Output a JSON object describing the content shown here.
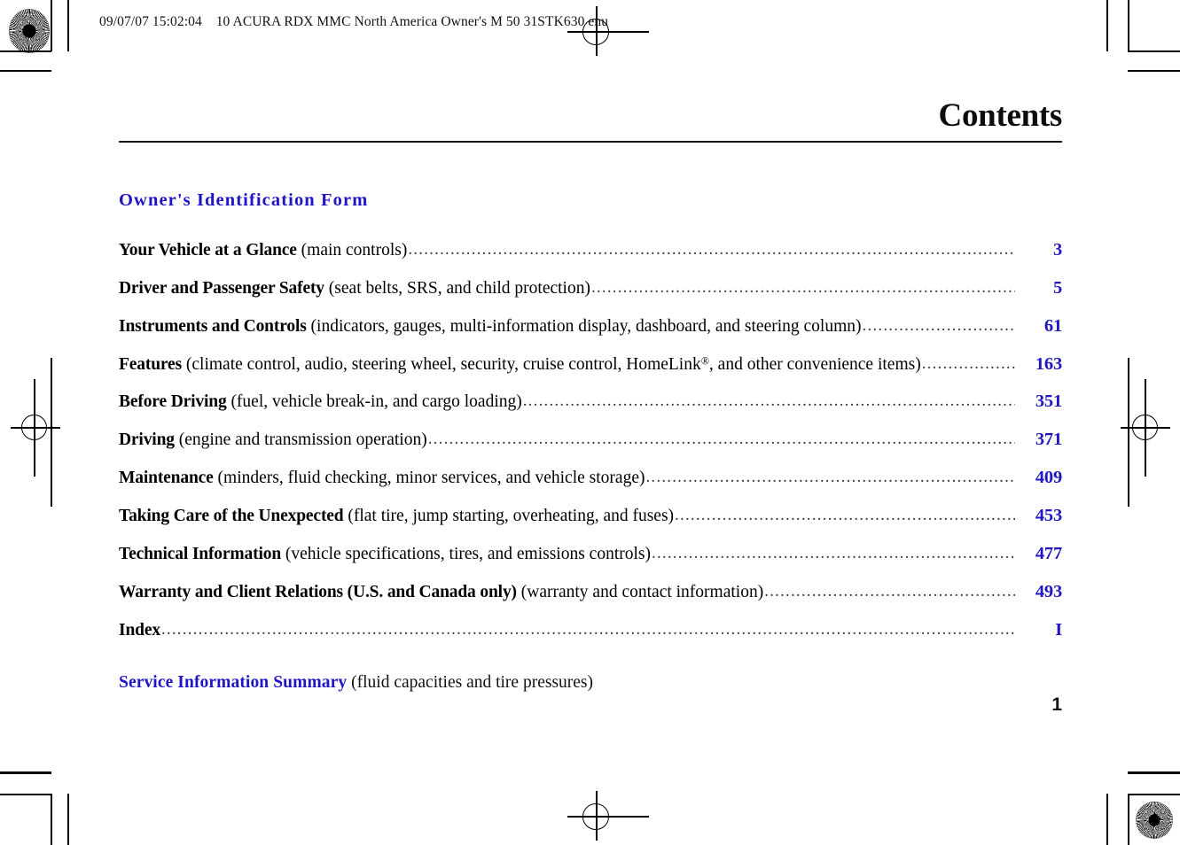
{
  "document": {
    "header_line": "09/07/07 15:02:04    10 ACURA RDX MMC North America Owner's M 50 31STK630 enu",
    "page_title": "Contents",
    "folio": "1",
    "accent_blue": "#1f15c4",
    "text_black": "#000000"
  },
  "section_heading": {
    "label": "Owner's Identification Form"
  },
  "toc": {
    "entries": [
      {
        "title": "Your Vehicle at a Glance",
        "description": "(main controls)",
        "page": "3"
      },
      {
        "title": "Driver and Passenger Safety",
        "description": "(seat belts, SRS, and child protection)",
        "page": "5"
      },
      {
        "title": "Instruments and Controls",
        "description": "(indicators, gauges, multi-information display, dashboard, and steering column)",
        "page": "61"
      },
      {
        "title": "Features",
        "description_pre": "(climate control, audio, steering wheel, security, cruise control, HomeLink",
        "description_sup": "®",
        "description_post": ", and other convenience items)",
        "page": "163"
      },
      {
        "title": "Before Driving",
        "description": "(fuel, vehicle break-in, and cargo loading)",
        "page": "351"
      },
      {
        "title": "Driving",
        "description": "(engine and transmission operation)",
        "page": "371"
      },
      {
        "title": "Maintenance",
        "description": "(minders, fluid checking, minor services, and vehicle storage)",
        "page": "409"
      },
      {
        "title": "Taking Care of the Unexpected",
        "description": "(flat tire, jump starting, overheating, and fuses)",
        "page": "453"
      },
      {
        "title": "Technical Information",
        "description": "(vehicle specifications, tires, and emissions controls)",
        "page": "477"
      },
      {
        "title": "Warranty and Client Relations (U.S. and Canada only)",
        "description": "(warranty and contact information)",
        "page": "493"
      },
      {
        "title": "Index",
        "description": "",
        "page": "I"
      }
    ]
  },
  "footnote": {
    "title": "Service Information Summary",
    "description": "(fluid capacities and tire pressures)"
  },
  "print_marks": {
    "top_left_target": "registration-starburst",
    "bottom_right_target": "registration-starburst",
    "top_center_target": "registration-crosshair",
    "bottom_center_target": "registration-crosshair",
    "left_target": "registration-crosshair",
    "right_target": "registration-crosshair"
  }
}
